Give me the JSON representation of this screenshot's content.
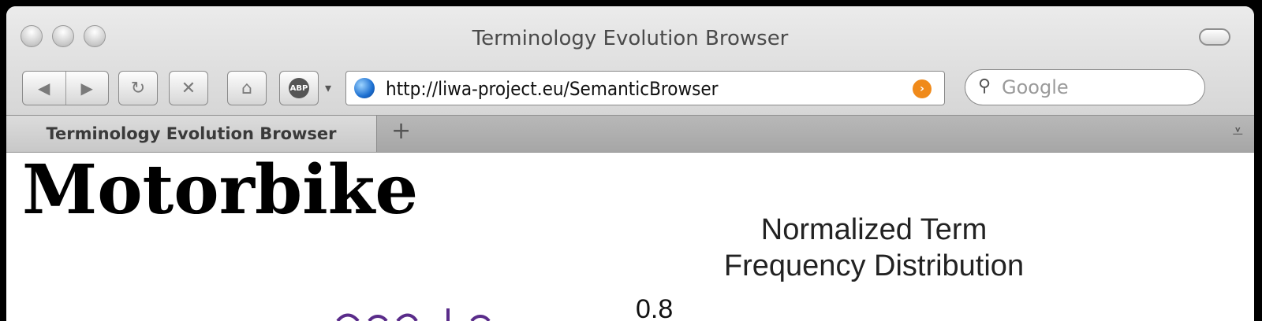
{
  "window": {
    "title": "Terminology Evolution Browser"
  },
  "toolbar": {
    "back_icon": "back-arrow-icon",
    "forward_icon": "forward-arrow-icon",
    "reload_icon": "reload-icon",
    "stop_icon": "stop-icon",
    "home_icon": "home-icon",
    "adblock_label": "ABP",
    "url": "http://liwa-project.eu/SemanticBrowser",
    "search_placeholder": "Google"
  },
  "tabs": [
    {
      "label": "Terminology Evolution Browser"
    }
  ],
  "page": {
    "heading": "Motorbike",
    "chart": {
      "title_line1": "Normalized Term",
      "title_line2": "Frequency Distribution",
      "visible_tick": "0.8"
    }
  },
  "colors": {
    "rss": "#f08a1a",
    "link_fragment": "#5a2c8a"
  }
}
